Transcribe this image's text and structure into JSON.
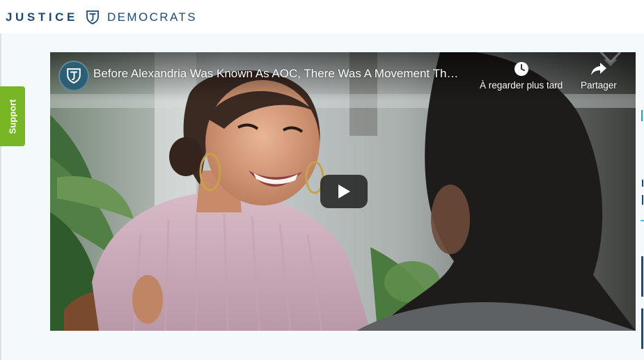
{
  "header": {
    "logo_word1": "JUSTICE",
    "logo_word2": "DEMOCRATS",
    "logo_color": "#1e4a72"
  },
  "support_tab": {
    "label": "Support",
    "color": "#79b626"
  },
  "video": {
    "title": "Before Alexandria Was Known As AOC, There Was A Movement Th…",
    "channel_avatar_icon": "justice-democrats-logo-icon",
    "watch_later_label": "À regarder plus tard",
    "watch_later_icon": "clock-icon",
    "share_label": "Partager",
    "share_icon": "share-arrow-icon",
    "play_icon": "play-icon",
    "thumbnail_description_icon": "video-thumbnail-image"
  },
  "colors": {
    "page_bg": "#f4fafb",
    "header_bg": "#ffffff",
    "play_button_bg": "#212121"
  }
}
